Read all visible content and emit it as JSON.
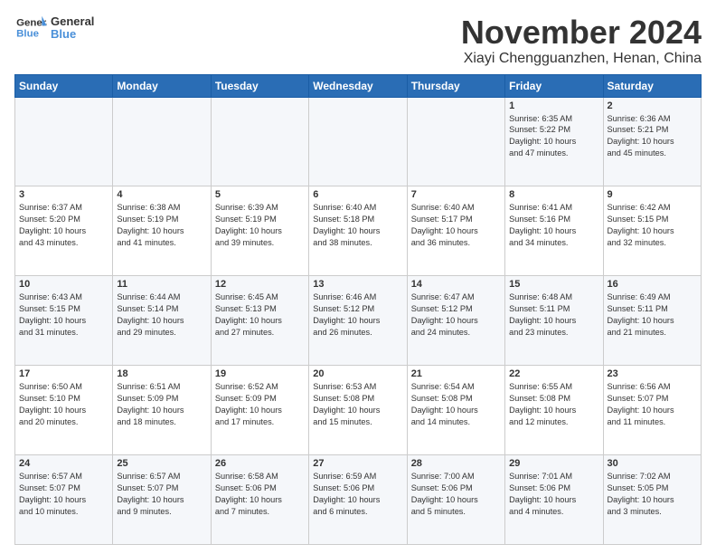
{
  "logo": {
    "line1": "General",
    "line2": "Blue"
  },
  "title": "November 2024",
  "location": "Xiayi Chengguanzhen, Henan, China",
  "weekdays": [
    "Sunday",
    "Monday",
    "Tuesday",
    "Wednesday",
    "Thursday",
    "Friday",
    "Saturday"
  ],
  "weeks": [
    [
      {
        "day": "",
        "info": ""
      },
      {
        "day": "",
        "info": ""
      },
      {
        "day": "",
        "info": ""
      },
      {
        "day": "",
        "info": ""
      },
      {
        "day": "",
        "info": ""
      },
      {
        "day": "1",
        "info": "Sunrise: 6:35 AM\nSunset: 5:22 PM\nDaylight: 10 hours\nand 47 minutes."
      },
      {
        "day": "2",
        "info": "Sunrise: 6:36 AM\nSunset: 5:21 PM\nDaylight: 10 hours\nand 45 minutes."
      }
    ],
    [
      {
        "day": "3",
        "info": "Sunrise: 6:37 AM\nSunset: 5:20 PM\nDaylight: 10 hours\nand 43 minutes."
      },
      {
        "day": "4",
        "info": "Sunrise: 6:38 AM\nSunset: 5:19 PM\nDaylight: 10 hours\nand 41 minutes."
      },
      {
        "day": "5",
        "info": "Sunrise: 6:39 AM\nSunset: 5:19 PM\nDaylight: 10 hours\nand 39 minutes."
      },
      {
        "day": "6",
        "info": "Sunrise: 6:40 AM\nSunset: 5:18 PM\nDaylight: 10 hours\nand 38 minutes."
      },
      {
        "day": "7",
        "info": "Sunrise: 6:40 AM\nSunset: 5:17 PM\nDaylight: 10 hours\nand 36 minutes."
      },
      {
        "day": "8",
        "info": "Sunrise: 6:41 AM\nSunset: 5:16 PM\nDaylight: 10 hours\nand 34 minutes."
      },
      {
        "day": "9",
        "info": "Sunrise: 6:42 AM\nSunset: 5:15 PM\nDaylight: 10 hours\nand 32 minutes."
      }
    ],
    [
      {
        "day": "10",
        "info": "Sunrise: 6:43 AM\nSunset: 5:15 PM\nDaylight: 10 hours\nand 31 minutes."
      },
      {
        "day": "11",
        "info": "Sunrise: 6:44 AM\nSunset: 5:14 PM\nDaylight: 10 hours\nand 29 minutes."
      },
      {
        "day": "12",
        "info": "Sunrise: 6:45 AM\nSunset: 5:13 PM\nDaylight: 10 hours\nand 27 minutes."
      },
      {
        "day": "13",
        "info": "Sunrise: 6:46 AM\nSunset: 5:12 PM\nDaylight: 10 hours\nand 26 minutes."
      },
      {
        "day": "14",
        "info": "Sunrise: 6:47 AM\nSunset: 5:12 PM\nDaylight: 10 hours\nand 24 minutes."
      },
      {
        "day": "15",
        "info": "Sunrise: 6:48 AM\nSunset: 5:11 PM\nDaylight: 10 hours\nand 23 minutes."
      },
      {
        "day": "16",
        "info": "Sunrise: 6:49 AM\nSunset: 5:11 PM\nDaylight: 10 hours\nand 21 minutes."
      }
    ],
    [
      {
        "day": "17",
        "info": "Sunrise: 6:50 AM\nSunset: 5:10 PM\nDaylight: 10 hours\nand 20 minutes."
      },
      {
        "day": "18",
        "info": "Sunrise: 6:51 AM\nSunset: 5:09 PM\nDaylight: 10 hours\nand 18 minutes."
      },
      {
        "day": "19",
        "info": "Sunrise: 6:52 AM\nSunset: 5:09 PM\nDaylight: 10 hours\nand 17 minutes."
      },
      {
        "day": "20",
        "info": "Sunrise: 6:53 AM\nSunset: 5:08 PM\nDaylight: 10 hours\nand 15 minutes."
      },
      {
        "day": "21",
        "info": "Sunrise: 6:54 AM\nSunset: 5:08 PM\nDaylight: 10 hours\nand 14 minutes."
      },
      {
        "day": "22",
        "info": "Sunrise: 6:55 AM\nSunset: 5:08 PM\nDaylight: 10 hours\nand 12 minutes."
      },
      {
        "day": "23",
        "info": "Sunrise: 6:56 AM\nSunset: 5:07 PM\nDaylight: 10 hours\nand 11 minutes."
      }
    ],
    [
      {
        "day": "24",
        "info": "Sunrise: 6:57 AM\nSunset: 5:07 PM\nDaylight: 10 hours\nand 10 minutes."
      },
      {
        "day": "25",
        "info": "Sunrise: 6:57 AM\nSunset: 5:07 PM\nDaylight: 10 hours\nand 9 minutes."
      },
      {
        "day": "26",
        "info": "Sunrise: 6:58 AM\nSunset: 5:06 PM\nDaylight: 10 hours\nand 7 minutes."
      },
      {
        "day": "27",
        "info": "Sunrise: 6:59 AM\nSunset: 5:06 PM\nDaylight: 10 hours\nand 6 minutes."
      },
      {
        "day": "28",
        "info": "Sunrise: 7:00 AM\nSunset: 5:06 PM\nDaylight: 10 hours\nand 5 minutes."
      },
      {
        "day": "29",
        "info": "Sunrise: 7:01 AM\nSunset: 5:06 PM\nDaylight: 10 hours\nand 4 minutes."
      },
      {
        "day": "30",
        "info": "Sunrise: 7:02 AM\nSunset: 5:05 PM\nDaylight: 10 hours\nand 3 minutes."
      }
    ]
  ]
}
